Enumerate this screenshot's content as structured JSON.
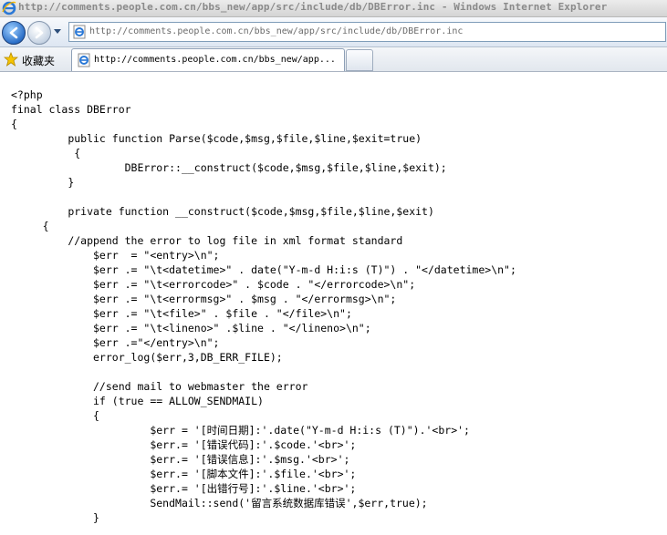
{
  "window": {
    "title": "http://comments.people.com.cn/bbs_new/app/src/include/db/DBError.inc - Windows Internet Explorer"
  },
  "navbar": {
    "address": "http://comments.people.com.cn/bbs_new/app/src/include/db/DBError.inc"
  },
  "favorites": {
    "label": "收藏夹"
  },
  "tabs": [
    {
      "title": "http://comments.people.com.cn/bbs_new/app..."
    }
  ],
  "content": {
    "lines": [
      "<?php",
      "final class DBError",
      "{",
      "\t public function Parse($code,$msg,$file,$line,$exit=true)",
      "\t  {",
      "\t\t  DBError::__construct($code,$msg,$file,$line,$exit);",
      "\t }",
      "",
      "\t private function __construct($code,$msg,$file,$line,$exit)",
      "     {",
      "\t //append the error to log file in xml format standard",
      "\t     $err  = \"<entry>\\n\";",
      "\t     $err .= \"\\t<datetime>\" . date(\"Y-m-d H:i:s (T)\") . \"</datetime>\\n\";",
      "\t     $err .= \"\\t<errorcode>\" . $code . \"</errorcode>\\n\";",
      "\t     $err .= \"\\t<errormsg>\" . $msg . \"</errormsg>\\n\";",
      "\t     $err .= \"\\t<file>\" . $file . \"</file>\\n\";",
      "\t     $err .= \"\\t<lineno>\" .$line . \"</lineno>\\n\";",
      "\t     $err .=\"</entry>\\n\";",
      "\t     error_log($err,3,DB_ERR_FILE);",
      "",
      "\t     //send mail to webmaster the error",
      "\t     if (true == ALLOW_SENDMAIL)",
      "\t     {",
      "\t\t      $err = '[时间日期]:'.date(\"Y-m-d H:i:s (T)\").'<br>';",
      "\t\t      $err.= '[错误代码]:'.$code.'<br>';",
      "\t\t      $err.= '[错误信息]:'.$msg.'<br>';",
      "\t\t      $err.= '[脚本文件]:'.$file.'<br>';",
      "\t\t      $err.= '[出错行号]:'.$line.'<br>';",
      "\t\t      SendMail::send('留言系统数据库错误',$err,true);",
      "\t     }"
    ]
  }
}
